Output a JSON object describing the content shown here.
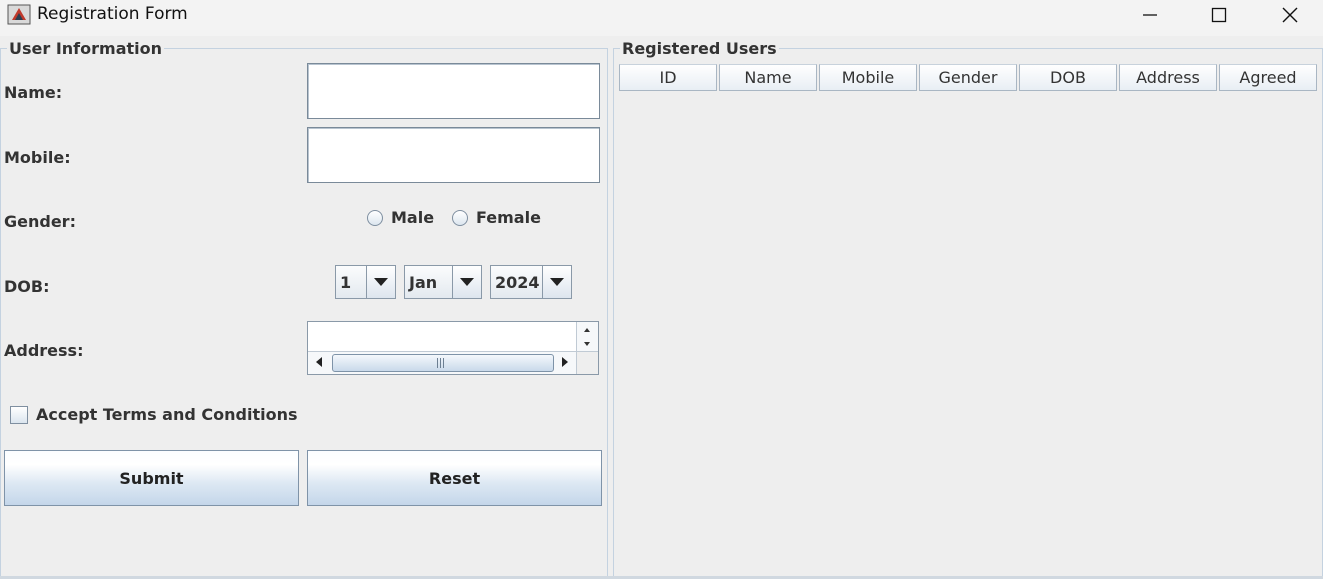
{
  "window": {
    "title": "Registration Form"
  },
  "left_panel": {
    "title": "User Information",
    "name_label": "Name:",
    "name_value": "",
    "mobile_label": "Mobile:",
    "mobile_value": "",
    "gender_label": "Gender:",
    "gender_options": [
      "Male",
      "Female"
    ],
    "dob_label": "DOB:",
    "dob_day": "1",
    "dob_month": "Jan",
    "dob_year": "2024",
    "address_label": "Address:",
    "address_value": "",
    "terms_label": "Accept Terms and Conditions",
    "terms_checked": false,
    "submit_label": "Submit",
    "reset_label": "Reset"
  },
  "right_panel": {
    "title": "Registered Users",
    "columns": [
      "ID",
      "Name",
      "Mobile",
      "Gender",
      "DOB",
      "Address",
      "Agreed"
    ],
    "rows": []
  }
}
